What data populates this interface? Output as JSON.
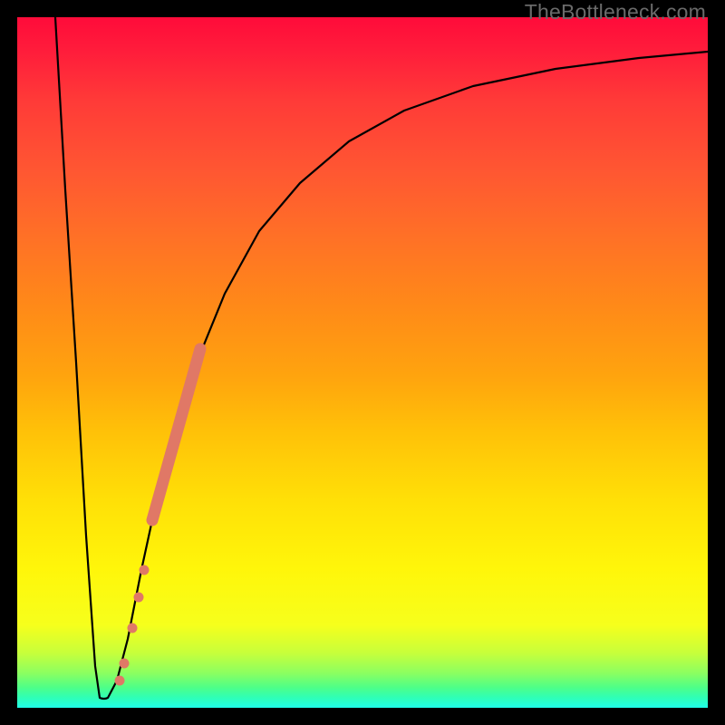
{
  "watermark": "TheBottleneck.com",
  "colors": {
    "frame": "#000000",
    "curve": "#000000",
    "marker": "#e07866"
  },
  "chart_data": {
    "type": "line",
    "title": "",
    "xlabel": "",
    "ylabel": "",
    "xlim": [
      0,
      100
    ],
    "ylim": [
      0,
      100
    ],
    "grid": false,
    "curve_points": [
      {
        "x": 5.5,
        "y": 100
      },
      {
        "x": 7.0,
        "y": 75
      },
      {
        "x": 8.5,
        "y": 50
      },
      {
        "x": 10.0,
        "y": 25
      },
      {
        "x": 11.3,
        "y": 6
      },
      {
        "x": 12.0,
        "y": 1.5
      },
      {
        "x": 13.2,
        "y": 1.5
      },
      {
        "x": 14.5,
        "y": 4
      },
      {
        "x": 16.0,
        "y": 10
      },
      {
        "x": 18.0,
        "y": 20
      },
      {
        "x": 20.0,
        "y": 29
      },
      {
        "x": 23.0,
        "y": 41
      },
      {
        "x": 26.0,
        "y": 50
      },
      {
        "x": 30.0,
        "y": 60
      },
      {
        "x": 35.0,
        "y": 69
      },
      {
        "x": 41.0,
        "y": 76
      },
      {
        "x": 48.0,
        "y": 82
      },
      {
        "x": 56.0,
        "y": 86.5
      },
      {
        "x": 66.0,
        "y": 90
      },
      {
        "x": 78.0,
        "y": 92.5
      },
      {
        "x": 90.0,
        "y": 94
      },
      {
        "x": 100.0,
        "y": 95
      }
    ],
    "highlight_band": {
      "start": {
        "x": 19.5,
        "y": 27
      },
      "end": {
        "x": 26.5,
        "y": 52
      }
    },
    "highlight_dots": [
      {
        "x": 14.8,
        "y": 4
      },
      {
        "x": 15.5,
        "y": 6.5
      },
      {
        "x": 16.6,
        "y": 11.5
      },
      {
        "x": 17.6,
        "y": 16
      },
      {
        "x": 18.4,
        "y": 20
      }
    ]
  }
}
